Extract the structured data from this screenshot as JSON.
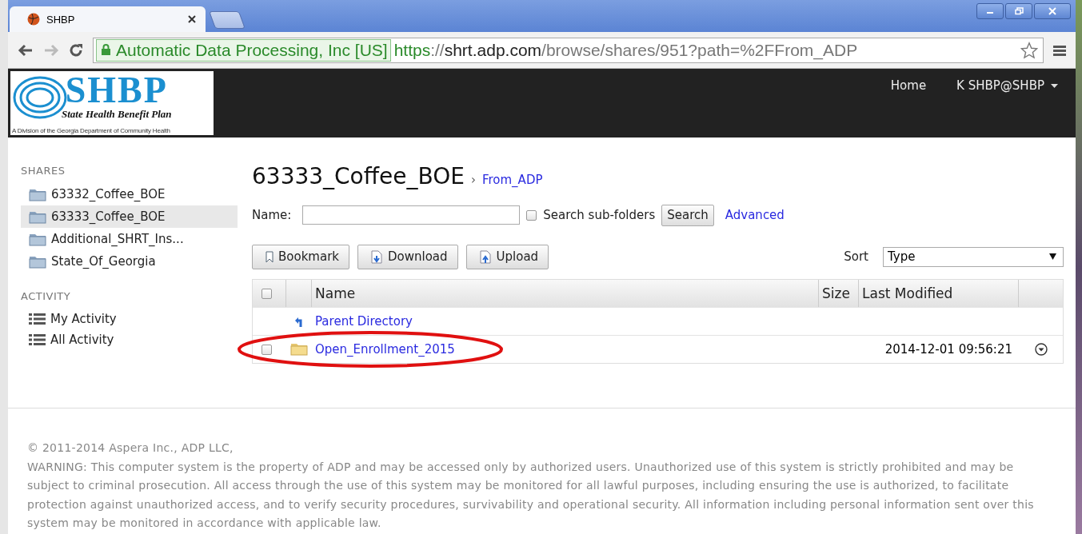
{
  "browser": {
    "tab_title": "SHBP",
    "identity": "Automatic Data Processing, Inc [US]",
    "url_parts": [
      {
        "text": "https",
        "kind": "scheme"
      },
      {
        "text": "://",
        "kind": "plain"
      },
      {
        "text": "shrt.adp.com",
        "kind": "host"
      },
      {
        "text": "/browse/shares/951?path=%2FFrom_ADP",
        "kind": "plain"
      }
    ]
  },
  "header": {
    "logo": {
      "brand": "SHBP",
      "name": "State Health Benefit Plan",
      "tagline": "A Division of the Georgia Department of Community Health"
    },
    "nav": [
      "Home"
    ],
    "user": "K SHBP@SHBP"
  },
  "sidebar": {
    "sections": [
      {
        "heading": "SHARES",
        "kind": "folder",
        "items": [
          {
            "label": "63332_Coffee_BOE",
            "selected": false
          },
          {
            "label": "63333_Coffee_BOE",
            "selected": true
          },
          {
            "label": "Additional_SHRT_Ins...",
            "selected": false
          },
          {
            "label": "State_Of_Georgia",
            "selected": false
          }
        ]
      },
      {
        "heading": "ACTIVITY",
        "kind": "list",
        "items": [
          {
            "label": "My Activity",
            "selected": false
          },
          {
            "label": "All Activity",
            "selected": false
          }
        ]
      }
    ]
  },
  "main": {
    "title": "63333_Coffee_BOE",
    "separator": "›",
    "breadcrumb": "From_ADP",
    "search": {
      "label": "Name:",
      "subfolders_label": "Search sub-folders",
      "subfolders_checked": false,
      "button": "Search",
      "advanced": "Advanced"
    },
    "actions": [
      {
        "label": "Bookmark",
        "kind": "bookmark"
      },
      {
        "label": "Download",
        "kind": "download"
      },
      {
        "label": "Upload",
        "kind": "upload"
      }
    ],
    "sort": {
      "label": "Sort",
      "value": "Type"
    },
    "table": {
      "select_all_checked": false,
      "columns": [
        "Name",
        "Size",
        "Last Modified"
      ],
      "rows": [
        {
          "kind": "parent",
          "name": "Parent Directory",
          "circled": false
        },
        {
          "kind": "folder",
          "name": "Open_Enrollment_2015",
          "modified": "2014-12-01 09:56:21",
          "checked": false,
          "circled": true
        }
      ]
    }
  },
  "footer": {
    "copyright": "© 2011-2014 Aspera Inc., ADP LLC,",
    "warning": "WARNING: This computer system is the property of ADP and may be accessed only by authorized users. Unauthorized use of this system is strictly prohibited and may be subject to criminal prosecution. All access through the use of this system may be monitored for all lawful purposes, including ensuring the use is authorized, to facilitate protection against unauthorized access, and to verify security procedures, survivability and operational security. All information including personal information sent over this system may be monitored in accordance with applicable law."
  }
}
